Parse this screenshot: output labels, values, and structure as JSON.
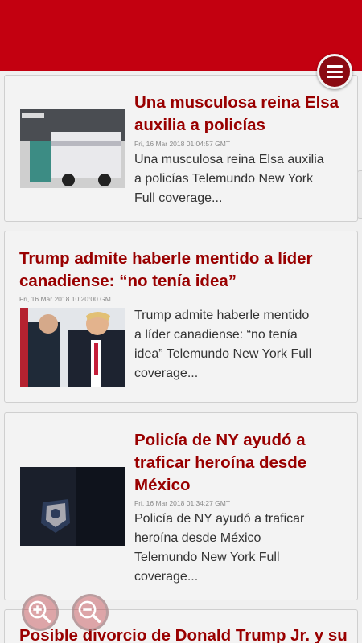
{
  "colors": {
    "header": "#c30010",
    "title": "#990000",
    "menu_button": "#8b0a12"
  },
  "header": {
    "menu_icon": "hamburger-menu-icon"
  },
  "articles": [
    {
      "title_lines": [
        "Una musculosa reina Elsa",
        "auxilia a policías"
      ],
      "date": "Fri, 16 Mar 2018 01:04:57 GMT",
      "desc_lines": [
        "Una musculosa reina Elsa auxilia",
        "a policías  Telemundo New York",
        "Full coverage..."
      ]
    },
    {
      "title_lines": [
        "Trump admite haberle mentido a líder",
        "canadiense: “no tenía idea”"
      ],
      "date": "Fri, 16 Mar 2018 10:20:00 GMT",
      "desc_lines": [
        "Trump admite haberle mentido",
        "a líder canadiense: “no tenía",
        "idea”  Telemundo New York  Full",
        "coverage..."
      ]
    },
    {
      "title_lines": [
        "Policía de NY ayudó a",
        "traficar heroína desde",
        "México"
      ],
      "date": "Fri, 16 Mar 2018 01:34:27 GMT",
      "desc_lines": [
        "Policía de NY ayudó a traficar",
        "heroína desde México",
        "Telemundo New York  Full",
        "coverage..."
      ]
    },
    {
      "title_lines": [
        "Posible divorcio de Donald Trump Jr. y su"
      ]
    }
  ],
  "zoom_controls": {
    "zoom_in_icon": "zoom-in-icon",
    "zoom_out_icon": "zoom-out-icon"
  }
}
